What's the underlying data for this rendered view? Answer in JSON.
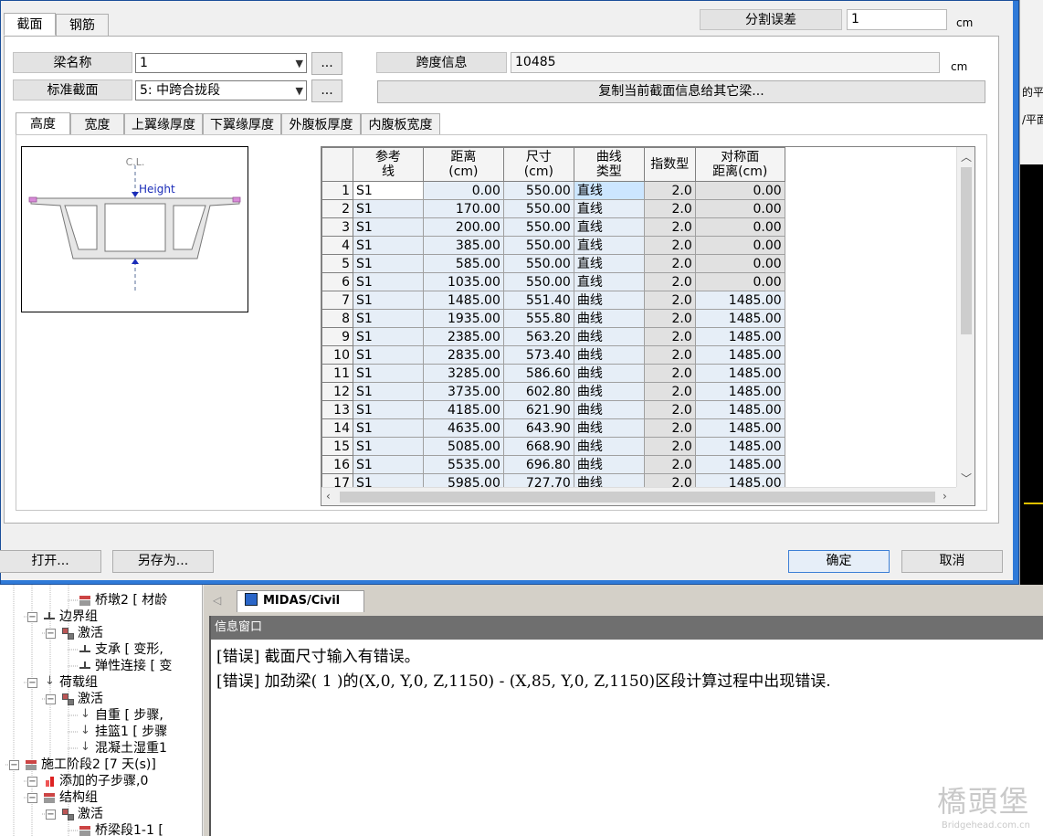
{
  "dialog": {
    "tabs": [
      "截面",
      "钢筋"
    ],
    "split_error_label": "分割误差",
    "split_error_value": "1",
    "unit_cm": "cm",
    "beam_name_label": "梁名称",
    "beam_name_value": "1",
    "std_section_label": "标准截面",
    "std_section_value": "5: 中跨合拢段",
    "ellipsis": "...",
    "span_info_label": "跨度信息",
    "span_info_value": "10485",
    "copy_button": "复制当前截面信息给其它梁...",
    "inner_tabs": [
      "高度",
      "宽度",
      "上翼缘厚度",
      "下翼缘厚度",
      "外腹板厚度",
      "内腹板宽度"
    ],
    "diagram": {
      "cl_label": "C.L.",
      "height_label": "Height"
    },
    "grid": {
      "headers": [
        "参考\n线",
        "距离\n(cm)",
        "尺寸\n(cm)",
        "曲线\n类型",
        "指数型",
        "对称面\n距离(cm)"
      ],
      "rows": [
        [
          "1",
          "S1",
          "0.00",
          "550.00",
          "直线",
          "2.0",
          "0.00"
        ],
        [
          "2",
          "S1",
          "170.00",
          "550.00",
          "直线",
          "2.0",
          "0.00"
        ],
        [
          "3",
          "S1",
          "200.00",
          "550.00",
          "直线",
          "2.0",
          "0.00"
        ],
        [
          "4",
          "S1",
          "385.00",
          "550.00",
          "直线",
          "2.0",
          "0.00"
        ],
        [
          "5",
          "S1",
          "585.00",
          "550.00",
          "直线",
          "2.0",
          "0.00"
        ],
        [
          "6",
          "S1",
          "1035.00",
          "550.00",
          "直线",
          "2.0",
          "0.00"
        ],
        [
          "7",
          "S1",
          "1485.00",
          "551.40",
          "曲线",
          "2.0",
          "1485.00"
        ],
        [
          "8",
          "S1",
          "1935.00",
          "555.80",
          "曲线",
          "2.0",
          "1485.00"
        ],
        [
          "9",
          "S1",
          "2385.00",
          "563.20",
          "曲线",
          "2.0",
          "1485.00"
        ],
        [
          "10",
          "S1",
          "2835.00",
          "573.40",
          "曲线",
          "2.0",
          "1485.00"
        ],
        [
          "11",
          "S1",
          "3285.00",
          "586.60",
          "曲线",
          "2.0",
          "1485.00"
        ],
        [
          "12",
          "S1",
          "3735.00",
          "602.80",
          "曲线",
          "2.0",
          "1485.00"
        ],
        [
          "13",
          "S1",
          "4185.00",
          "621.90",
          "曲线",
          "2.0",
          "1485.00"
        ],
        [
          "14",
          "S1",
          "4635.00",
          "643.90",
          "曲线",
          "2.0",
          "1485.00"
        ],
        [
          "15",
          "S1",
          "5085.00",
          "668.90",
          "曲线",
          "2.0",
          "1485.00"
        ],
        [
          "16",
          "S1",
          "5535.00",
          "696.80",
          "曲线",
          "2.0",
          "1485.00"
        ],
        [
          "17",
          "S1",
          "5985.00",
          "727.70",
          "曲线",
          "2.0",
          "1485.00"
        ]
      ]
    },
    "open_button": "打开...",
    "save_as_button": "另存为...",
    "ok_button": "确定",
    "cancel_button": "取消"
  },
  "bg_app": {
    "right_labels": [
      "的平",
      "/平面"
    ],
    "tree": [
      {
        "label": "桥墩2 [ 材龄",
        "level": 4,
        "icon": "stage"
      },
      {
        "label": "边界组",
        "level": 2,
        "icon": "sup"
      },
      {
        "label": "激活",
        "level": 3,
        "icon": "act"
      },
      {
        "label": "支承 [ 变形,",
        "level": 4,
        "icon": "sup"
      },
      {
        "label": "弹性连接 [ 变",
        "level": 4,
        "icon": "sup"
      },
      {
        "label": "荷载组",
        "level": 2,
        "icon": "load"
      },
      {
        "label": "激活",
        "level": 3,
        "icon": "act"
      },
      {
        "label": "自重 [ 步骤,",
        "level": 4,
        "icon": "load"
      },
      {
        "label": "挂篮1 [ 步骤",
        "level": 4,
        "icon": "load"
      },
      {
        "label": "混凝土湿重1",
        "level": 4,
        "icon": "load"
      },
      {
        "label": "施工阶段2 [7 天(s)]",
        "level": 1,
        "icon": "stage"
      },
      {
        "label": "添加的子步骤,0",
        "level": 2,
        "icon": "add"
      },
      {
        "label": "结构组",
        "level": 2,
        "icon": "stage"
      },
      {
        "label": "激活",
        "level": 3,
        "icon": "act"
      },
      {
        "label": "桥梁段1-1 [",
        "level": 4,
        "icon": "stage"
      }
    ],
    "doc_tab": "MIDAS/Civil",
    "info_title": "信息窗口",
    "info_lines": [
      "[错误] 截面尺寸输入有错误。",
      "[错误] 加劲梁( 1 )的(X,0, Y,0, Z,1150) - (X,85, Y,0, Z,1150)区段计算过程中出现错误."
    ],
    "watermark_cn": "橋頭堡",
    "watermark_en": "Bridgehead.com.cn"
  },
  "colors": {
    "title_blue": "#2f7ad8",
    "selection": "#cce6ff",
    "readonly_cell": "#e1e1e1"
  }
}
